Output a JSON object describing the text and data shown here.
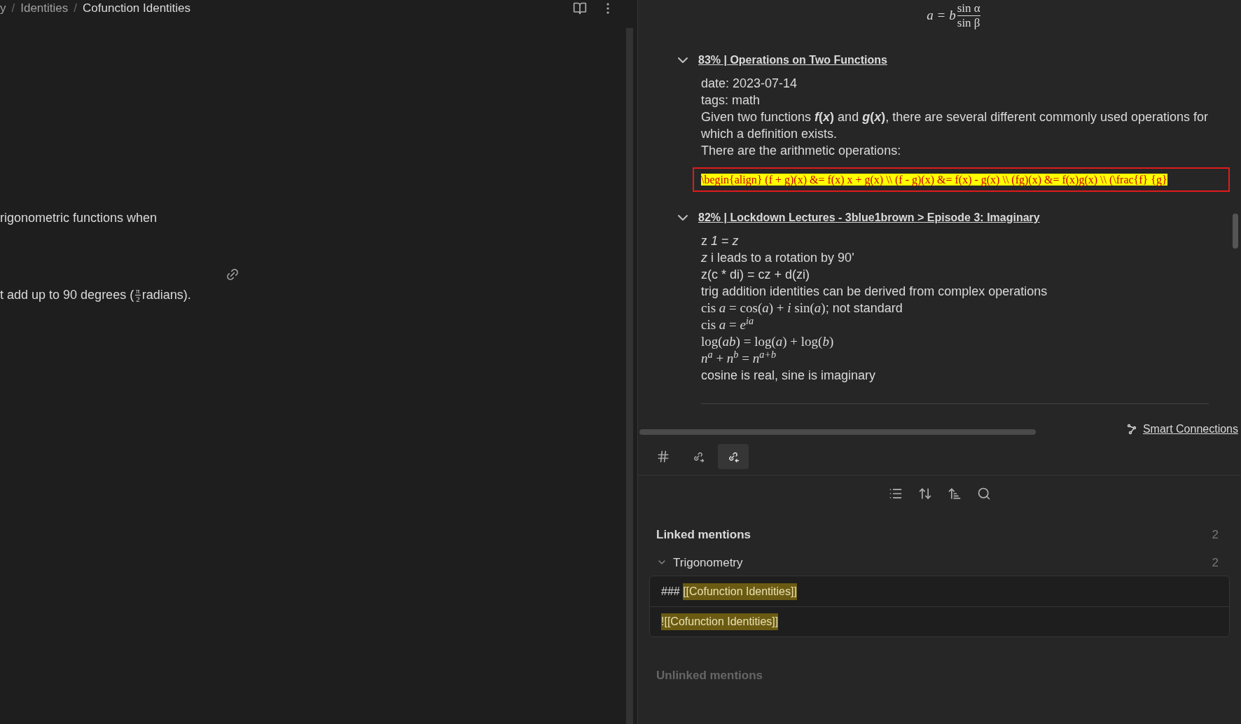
{
  "editor": {
    "breadcrumb": [
      "y",
      "/",
      "Identities",
      "/",
      "Cofunction Identities"
    ],
    "lines": [
      {
        "kind": "text",
        "text": "rigonometric functions when"
      },
      {
        "kind": "anchor"
      },
      {
        "kind": "fraction",
        "before": "t add up to 90 degrees (",
        "numerator": "π",
        "denominator": "2",
        "after": " radians)."
      }
    ]
  },
  "connections": {
    "formula": {
      "lhs": "a = b",
      "numerator": "sin α",
      "denominator": "sin β"
    },
    "results": [
      {
        "title": "83% | Operations on Two Functions",
        "expanded": true,
        "lines": [
          {
            "kind": "text",
            "text": "date: 2023-07-14"
          },
          {
            "kind": "text",
            "text": "tags: math"
          },
          {
            "kind": "text",
            "text": "Given two functions ***f*(*x*)** and ***g*(*x*)**, there are several different commonly used operations for which a definition exists."
          },
          {
            "kind": "text",
            "text": "There are the arithmetic operations:"
          },
          {
            "kind": "error",
            "text": "\\begin{align} (f + g)(x) &= f(x) x + g(x) \\\\ (f - g)(x) &= f(x) - g(x) \\\\ (fg)(x) &= f(x)g(x) \\\\ (\\frac{f} {g}"
          }
        ]
      },
      {
        "title": "82% | Lockdown Lectures - 3blue1brown > Episode 3: Imaginary",
        "expanded": true,
        "lines": [
          {
            "kind": "text",
            "text": "z *1* = *z*"
          },
          {
            "kind": "text",
            "text": "*z* i leads to a rotation by 90'"
          },
          {
            "kind": "text",
            "text": "z(c * di) = cz + d(zi)"
          },
          {
            "kind": "text",
            "text": "trig addition identities can be derived from complex operations"
          },
          {
            "kind": "math",
            "text": "cis *a* = cos(*a*) + *i* sin(*a*)",
            "after": "; not standard"
          },
          {
            "kind": "math",
            "text": "cis *a* = *e*$^{ia}$"
          },
          {
            "kind": "math",
            "text": "log(*ab*) = log(*a*) + log(*b*)"
          },
          {
            "kind": "math",
            "text": "*n*$^{a}$ + *n*$^{b}$ = *n*$^{a+b}$"
          },
          {
            "kind": "text",
            "text": "cosine is real, sine is imaginary"
          }
        ]
      }
    ],
    "footer_link": "Smart Connections"
  },
  "tabs": [
    {
      "kind": "tags",
      "selected": false
    },
    {
      "kind": "outgoing",
      "selected": false
    },
    {
      "kind": "backlinks",
      "selected": true
    }
  ],
  "backlinks": {
    "linked": {
      "title": "Linked mentions",
      "count": "2",
      "groups": [
        {
          "title": "Trigonometry",
          "count": "2",
          "expanded": true,
          "mentions": [
            {
              "prefix": "### ",
              "highlight": "[[Cofunction Identities]]"
            },
            {
              "highlight": "![[Cofunction Identities]]"
            }
          ]
        }
      ]
    },
    "unlinked": {
      "title": "Unlinked mentions",
      "disabled": true
    }
  }
}
